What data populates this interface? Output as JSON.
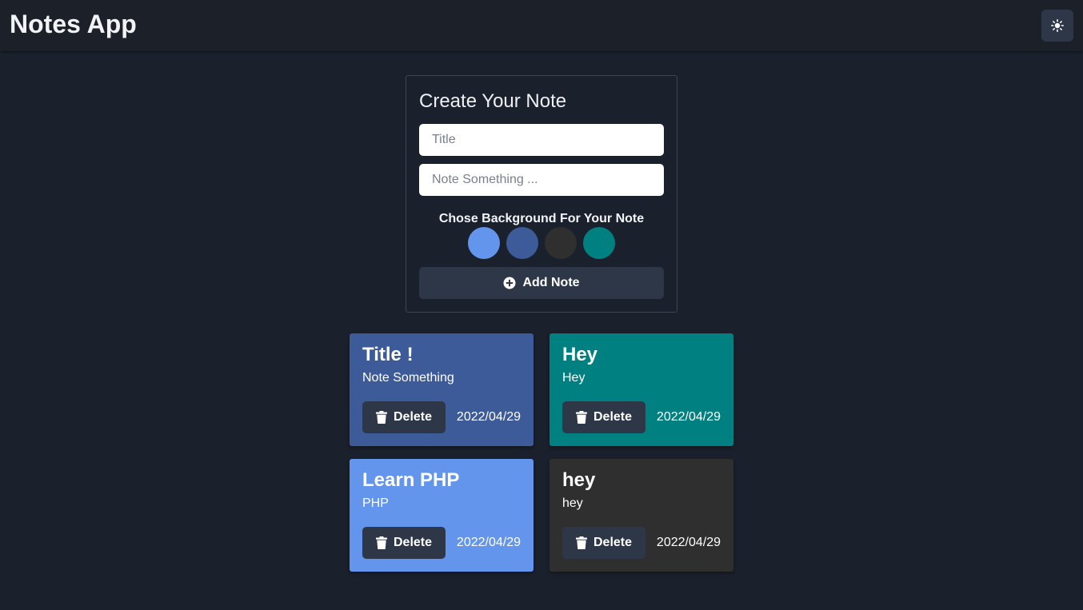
{
  "header": {
    "app_title": "Notes App",
    "theme_toggle_icon": "sun-icon"
  },
  "create_form": {
    "heading": "Create Your Note",
    "title_placeholder": "Title",
    "note_placeholder": "Note Something ...",
    "background_label": "Chose Background For Your Note",
    "swatches": [
      "#6495ed",
      "#3d5a99",
      "#2f2f2f",
      "#008080"
    ],
    "add_button_label": "Add Note",
    "add_button_icon": "plus-circle-icon"
  },
  "notes": [
    {
      "title": "Title !",
      "body": "Note Something",
      "date": "2022/04/29",
      "color": "#3d5a99",
      "delete_label": "Delete"
    },
    {
      "title": "Hey",
      "body": "Hey",
      "date": "2022/04/29",
      "color": "#008080",
      "delete_label": "Delete"
    },
    {
      "title": "Learn PHP",
      "body": "PHP",
      "date": "2022/04/29",
      "color": "#6495ed",
      "delete_label": "Delete"
    },
    {
      "title": "hey",
      "body": "hey",
      "date": "2022/04/29",
      "color": "#2f2f2f",
      "delete_label": "Delete"
    }
  ],
  "colors": {
    "page_background": "#1a202c",
    "header_background": "#1b2029",
    "button_background": "#2d3748"
  }
}
